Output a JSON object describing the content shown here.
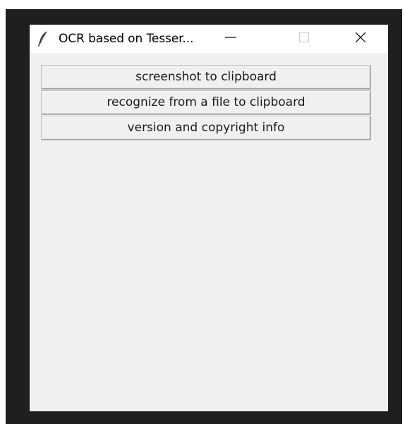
{
  "window": {
    "title": "OCR based on Tesser...",
    "app_icon": "feather-icon",
    "controls": {
      "minimize_icon": "minimize-icon",
      "maximize_icon": "maximize-icon",
      "close_icon": "close-icon"
    }
  },
  "buttons": [
    {
      "label": "screenshot to clipboard"
    },
    {
      "label": "recognize from a file to clipboard"
    },
    {
      "label": "version and copyright info"
    }
  ]
}
